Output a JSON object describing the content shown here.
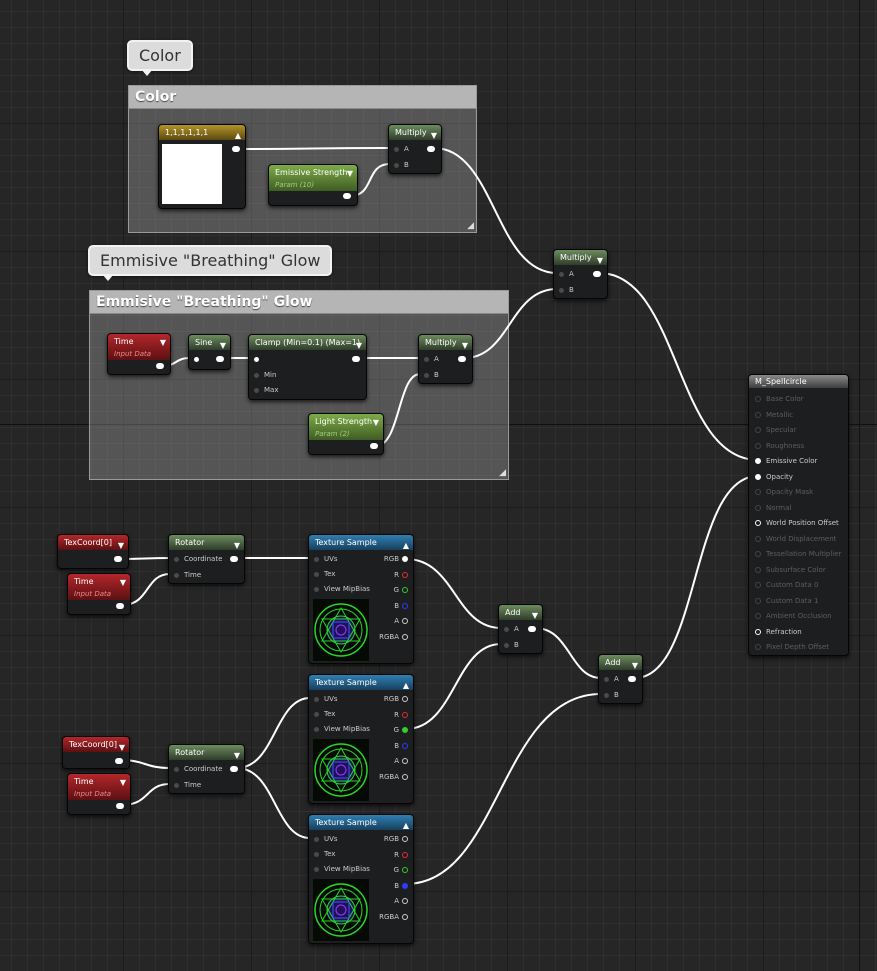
{
  "comments": [
    {
      "bubble": "Color",
      "title": "Color"
    },
    {
      "bubble": "Emmisive \"Breathing\" Glow",
      "title": "Emmisive \"Breathing\" Glow"
    }
  ],
  "nodes": {
    "constant4": {
      "title": "1,1,1,1,1,1"
    },
    "emissive_strength": {
      "title": "Emissive Strength",
      "subtitle": "Param (10)"
    },
    "multiply_color": {
      "title": "Multiply",
      "pin_a": "A",
      "pin_b": "B"
    },
    "multiply_main": {
      "title": "Multiply",
      "pin_a": "A",
      "pin_b": "B"
    },
    "time_glow": {
      "title": "Time",
      "subtitle": "Input Data"
    },
    "sine": {
      "title": "Sine"
    },
    "clamp": {
      "title": "Clamp (Min=0.1) (Max=1)",
      "pin_min": "Min",
      "pin_max": "Max"
    },
    "multiply_glow": {
      "title": "Multiply",
      "pin_a": "A",
      "pin_b": "B"
    },
    "light_strength": {
      "title": "Light Strength",
      "subtitle": "Param (2)"
    },
    "texcoord1": {
      "title": "TexCoord[0]"
    },
    "time1": {
      "title": "Time",
      "subtitle": "Input Data"
    },
    "rotator1": {
      "title": "Rotator",
      "pin_coord": "Coordinate",
      "pin_time": "Time"
    },
    "texcoord2": {
      "title": "TexCoord[0]"
    },
    "time2": {
      "title": "Time",
      "subtitle": "Input Data"
    },
    "rotator2": {
      "title": "Rotator",
      "pin_coord": "Coordinate",
      "pin_time": "Time"
    },
    "tex_sample": {
      "title": "Texture Sample",
      "inputs": [
        "UVs",
        "Tex",
        "View MipBias"
      ],
      "outputs": [
        "RGB",
        "R",
        "G",
        "B",
        "A",
        "RGBA"
      ]
    },
    "add1": {
      "title": "Add",
      "pin_a": "A",
      "pin_b": "B"
    },
    "add2": {
      "title": "Add",
      "pin_a": "A",
      "pin_b": "B"
    },
    "material": {
      "title": "M_Spellcircle",
      "pins": [
        {
          "label": "Base Color",
          "active": false
        },
        {
          "label": "Metallic",
          "active": false
        },
        {
          "label": "Specular",
          "active": false
        },
        {
          "label": "Roughness",
          "active": false
        },
        {
          "label": "Emissive Color",
          "active": true
        },
        {
          "label": "Opacity",
          "active": true
        },
        {
          "label": "Opacity Mask",
          "active": false
        },
        {
          "label": "Normal",
          "active": false
        },
        {
          "label": "World Position Offset",
          "active": true
        },
        {
          "label": "World Displacement",
          "active": false
        },
        {
          "label": "Tessellation Multiplier",
          "active": false
        },
        {
          "label": "Subsurface Color",
          "active": false
        },
        {
          "label": "Custom Data 0",
          "active": false
        },
        {
          "label": "Custom Data 1",
          "active": false
        },
        {
          "label": "Ambient Occlusion",
          "active": false
        },
        {
          "label": "Refraction",
          "active": true
        },
        {
          "label": "Pixel Depth Offset",
          "active": false
        }
      ]
    }
  },
  "colors": {
    "background": "#262626",
    "wire": "#ffffff",
    "param_header": "#7dab48",
    "input_header": "#b3272b",
    "texture_header": "#2f7fb3",
    "constant_header": "#b3932a"
  }
}
